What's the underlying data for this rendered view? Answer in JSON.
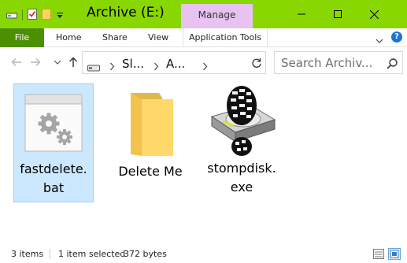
{
  "window": {
    "title": "Archive (E:)",
    "contextual_tab": "Manage",
    "accent_color": "#89d700",
    "file_tab_color": "#4c8f00"
  },
  "ribbon": {
    "tabs": [
      "File",
      "Home",
      "Share",
      "View",
      "Application Tools"
    ]
  },
  "address": {
    "crumbs": [
      "Sl...",
      "A..."
    ]
  },
  "search": {
    "placeholder": "Search Archiv..."
  },
  "files": [
    {
      "name_line1": "fastdelete.",
      "name_line2": "bat",
      "icon": "batch-file-gears-icon",
      "selected": true
    },
    {
      "name_line1": "Delete Me",
      "name_line2": "",
      "icon": "folder-icon",
      "selected": false
    },
    {
      "name_line1": "stompdisk.",
      "name_line2": "exe",
      "icon": "hard-drive-bootprint-icon",
      "selected": false
    }
  ],
  "status": {
    "count": "3 items",
    "selection": "1 item selected",
    "size": "372 bytes"
  }
}
